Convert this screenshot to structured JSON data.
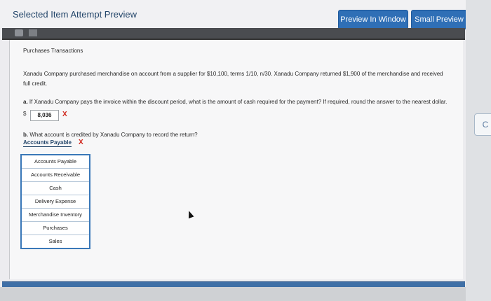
{
  "window": {
    "title": "Selected Item Attempt Preview",
    "buttons": {
      "preview_in_window": "Preview In Window",
      "small_preview": "Small Preview"
    }
  },
  "question": {
    "heading": "Purchases Transactions",
    "paragraph": "Xanadu Company purchased merchandise on account from a supplier for $10,100, terms 1/10, n/30. Xanadu Company returned $1,900 of the merchandise and received full credit.",
    "part_a": {
      "label": "a.",
      "text": "If Xanadu Company pays the invoice within the discount period, what is the amount of cash required for the payment? If required, round the answer to the nearest dollar.",
      "currency": "$",
      "answer": "8,036",
      "mark": "X"
    },
    "part_b": {
      "label": "b.",
      "text": "What account is credited by Xanadu Company to record the return?",
      "selected": "Accounts Payable",
      "mark": "X",
      "options": [
        "Accounts Payable",
        "Accounts Receivable",
        "Cash",
        "Delivery Expense",
        "Merchandise Inventory",
        "Purchases",
        "Sales"
      ]
    }
  },
  "side_tab": "C",
  "colors": {
    "accent": "#2f6fb6",
    "wrong": "#d0261c",
    "title": "#24466a"
  }
}
